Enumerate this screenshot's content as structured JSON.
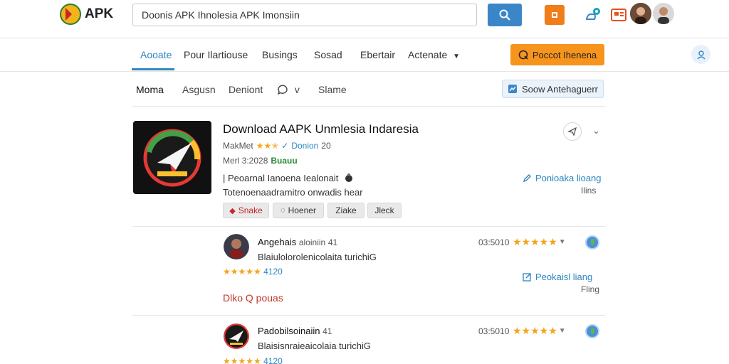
{
  "header": {
    "logo_text": "APK",
    "search_value": "Doonis APK Ihnolesia APK Imonsiin",
    "colors": {
      "search": "#3b86c8",
      "orange": "#f7941d"
    }
  },
  "nav": {
    "items": [
      "Aooate",
      "Pour Ilartiouse",
      "Busings",
      "Sosad",
      "Ebertair",
      "Actenate"
    ],
    "report_label": "Poccot Ihenena"
  },
  "subnav": {
    "items": [
      "Moma",
      "Asgusn",
      "Deniont",
      "v",
      "Slame"
    ],
    "show_label": "Soow Antehaguerr"
  },
  "app": {
    "title": "Download AAPK Unmlesia Indaresia",
    "meta1_prefix": "MakMet",
    "meta1_link": "Donion",
    "meta1_count": "20",
    "meta2_date": "Merl 3:2028",
    "meta2_badge": "Buauu",
    "desc1": "| Peoarnal Ianoena Iealonait",
    "desc2": "Totenoenaadramitro onwadis hear",
    "tags": [
      "Snake",
      "Hoener",
      "Ziake",
      "Jleck"
    ],
    "side_link": "Ponioaka lioang",
    "side_sub": "Ilins"
  },
  "reviews": [
    {
      "name": "Angehais",
      "handle": "aloiniin",
      "count": "41",
      "text": "Blaiulolorolenicolaita turichiG",
      "rating_value": "4120",
      "date": "03:5010",
      "side_link": "Peokaisl liang",
      "side_sub": "Fling"
    },
    {
      "name": "Padobilsoinaiin",
      "handle": "",
      "count": "41",
      "text": "Blaisisnraieaicolaia turichiG",
      "rating_value": "4120",
      "date": "03:5010"
    }
  ],
  "more_label": "Dlko Q pouas"
}
